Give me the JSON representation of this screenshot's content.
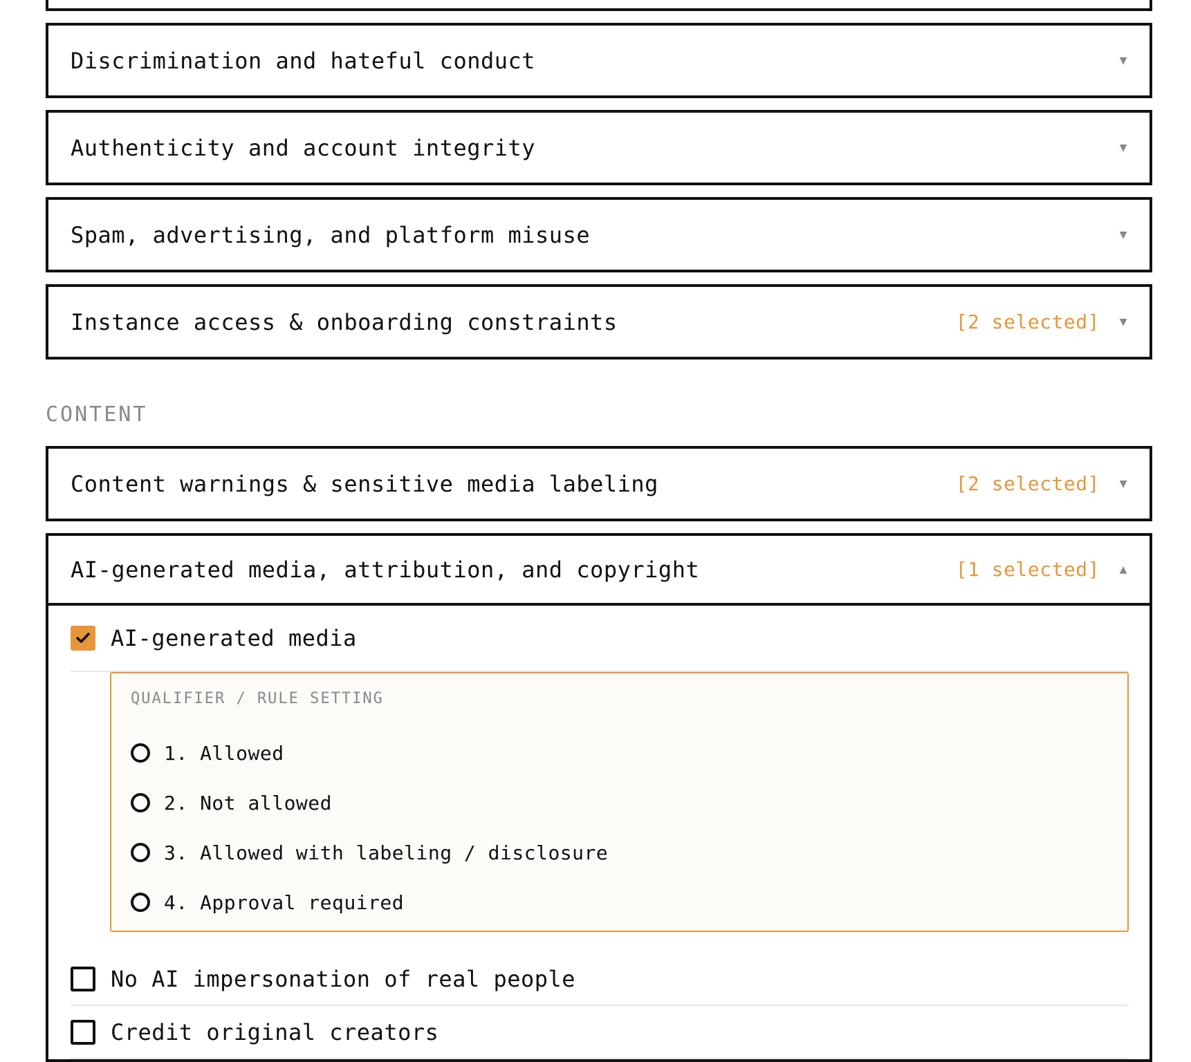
{
  "sections": {
    "top_items": [
      {
        "title": "Discrimination and hateful conduct",
        "count": ""
      },
      {
        "title": "Authenticity and account integrity",
        "count": ""
      },
      {
        "title": "Spam, advertising, and platform misuse",
        "count": ""
      },
      {
        "title": "Instance access & onboarding constraints",
        "count": "[2 selected]"
      }
    ],
    "content_label": "CONTENT",
    "content_items": [
      {
        "title": "Content warnings & sensitive media labeling",
        "count": "[2 selected]"
      }
    ]
  },
  "open_section": {
    "title": "AI-generated media, attribution, and copyright",
    "count": "[1 selected]",
    "options": [
      {
        "label": "AI-generated media",
        "checked": true
      },
      {
        "label": "No AI impersonation of real people",
        "checked": false
      },
      {
        "label": "Credit original creators",
        "checked": false
      }
    ],
    "qualifier": {
      "label": "QUALIFIER / RULE SETTING",
      "choices": [
        "1. Allowed",
        "2. Not allowed",
        "3. Allowed with labeling / disclosure",
        "4. Approval required"
      ]
    }
  },
  "icons": {
    "collapsed": "chevron-down-icon",
    "expanded": "chevron-up-icon",
    "check": "check-icon"
  },
  "colors": {
    "accent": "#e8963a",
    "muted": "#888888",
    "border": "#111111"
  }
}
